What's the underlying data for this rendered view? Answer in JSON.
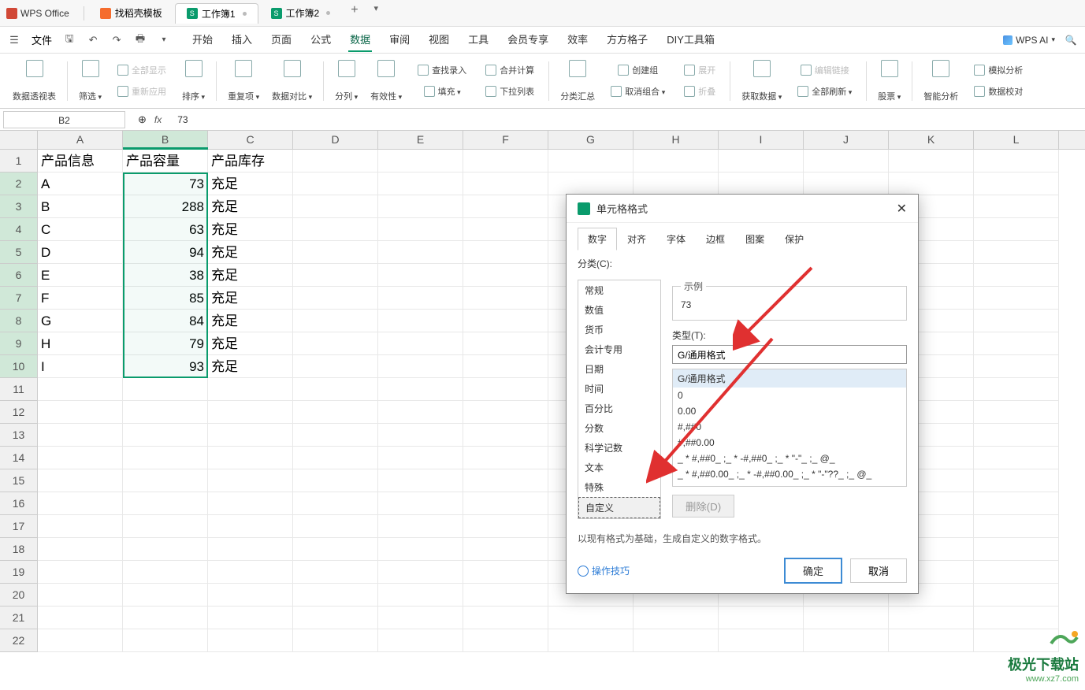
{
  "app_name": "WPS Office",
  "tabs": [
    {
      "label": "找稻壳模板",
      "type": "orange"
    },
    {
      "label": "工作簿1",
      "type": "green",
      "active": true,
      "has_dot": true
    },
    {
      "label": "工作簿2",
      "type": "green",
      "has_dot": true
    }
  ],
  "menu": {
    "file": "文件",
    "items": [
      "开始",
      "插入",
      "页面",
      "公式",
      "数据",
      "审阅",
      "视图",
      "工具",
      "会员专享",
      "效率",
      "方方格子",
      "DIY工具箱"
    ],
    "active": "数据",
    "ai": "WPS AI"
  },
  "ribbon": {
    "g1": {
      "pivot": "数据透视表"
    },
    "g2": {
      "filter": "筛选",
      "show_all": "全部显示",
      "reapply": "重新应用"
    },
    "g3": {
      "sort": "排序"
    },
    "g4": {
      "dup": "重复项",
      "valid": "数据对比"
    },
    "g5": {
      "split": "分列",
      "validity": "有效性"
    },
    "g6": {
      "find_input": "查找录入",
      "drop_list": "下拉列表",
      "merge_calc": "合并计算",
      "fill": "填充"
    },
    "g7": {
      "subtotal": "分类汇总",
      "group": "创建组",
      "ungroup": "取消组合",
      "expand": "展开",
      "collapse": "折叠"
    },
    "g8": {
      "get_data": "获取数据",
      "edit_link": "编辑链接",
      "refresh_all": "全部刷新"
    },
    "g9": {
      "stock": "股票"
    },
    "g10": {
      "smart_analysis": "智能分析",
      "simulate": "模拟分析",
      "data_check": "数据校对"
    }
  },
  "cell_ref": "B2",
  "formula_value": "73",
  "headers": [
    "产品信息",
    "产品容量",
    "产品库存"
  ],
  "rows": [
    {
      "a": "A",
      "b": "73",
      "c": "充足"
    },
    {
      "a": "B",
      "b": "288",
      "c": "充足"
    },
    {
      "a": "C",
      "b": "63",
      "c": "充足"
    },
    {
      "a": "D",
      "b": "94",
      "c": "充足"
    },
    {
      "a": "E",
      "b": "38",
      "c": "充足"
    },
    {
      "a": "F",
      "b": "85",
      "c": "充足"
    },
    {
      "a": "G",
      "b": "84",
      "c": "充足"
    },
    {
      "a": "H",
      "b": "79",
      "c": "充足"
    },
    {
      "a": "I",
      "b": "93",
      "c": "充足"
    }
  ],
  "cols": [
    "A",
    "B",
    "C",
    "D",
    "E",
    "F",
    "G",
    "H",
    "I",
    "J",
    "K",
    "L"
  ],
  "dialog": {
    "title": "单元格格式",
    "tabs": [
      "数字",
      "对齐",
      "字体",
      "边框",
      "图案",
      "保护"
    ],
    "active_tab": "数字",
    "category_label": "分类(C):",
    "categories": [
      "常规",
      "数值",
      "货币",
      "会计专用",
      "日期",
      "时间",
      "百分比",
      "分数",
      "科学记数",
      "文本",
      "特殊",
      "自定义"
    ],
    "selected_category": "自定义",
    "sample_label": "示例",
    "sample_value": "73",
    "type_label": "类型(T):",
    "type_value": "G/通用格式",
    "type_list": [
      "G/通用格式",
      "0",
      "0.00",
      "#,##0",
      "#,##0.00",
      "_ * #,##0_ ;_ * -#,##0_ ;_ * \"-\"_ ;_ @_",
      "_ * #,##0.00_ ;_ * -#,##0.00_ ;_ * \"-\"??_ ;_ @_"
    ],
    "delete_btn": "删除(D)",
    "hint": "以现有格式为基础，生成自定义的数字格式。",
    "tips": "操作技巧",
    "ok": "确定",
    "cancel": "取消"
  },
  "watermark": {
    "line1": "极光下载站",
    "line2": "www.xz7.com"
  }
}
